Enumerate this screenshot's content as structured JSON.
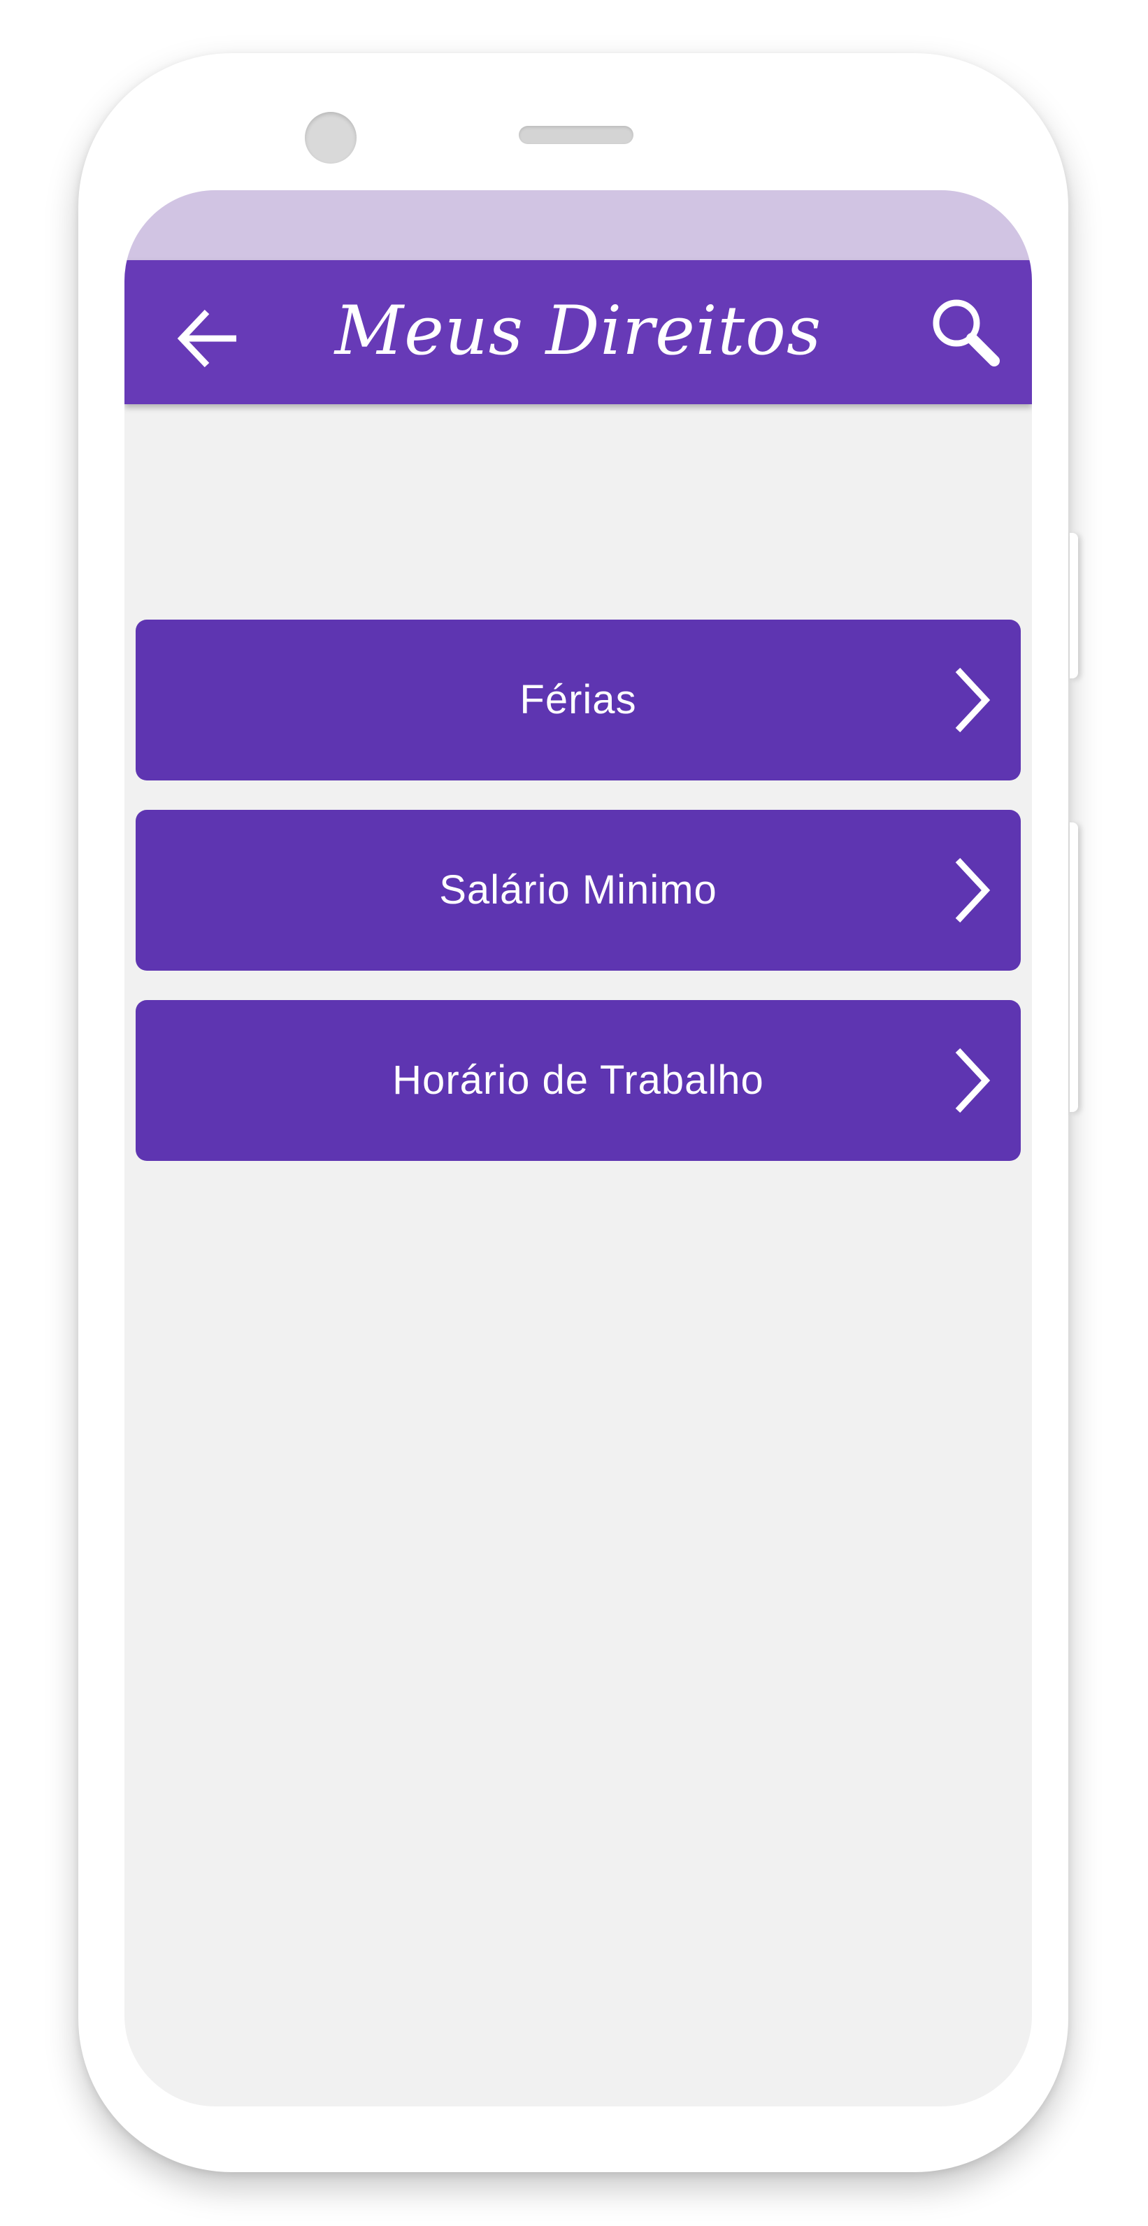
{
  "app_bar": {
    "title": "Meus Direitos",
    "back_icon": "arrow-left-icon",
    "search_icon": "search-icon"
  },
  "menu": {
    "items": [
      {
        "label": "Férias",
        "icon": "chevron-right-icon"
      },
      {
        "label": "Salário Minimo",
        "icon": "chevron-right-icon"
      },
      {
        "label": "Horário de Trabalho",
        "icon": "chevron-right-icon"
      }
    ]
  },
  "colors": {
    "primary": "#673ab7",
    "status_bar": "#d1c4e3",
    "button": "#5e35b1",
    "background": "#f1f1f1",
    "text_on_primary": "#ffffff"
  }
}
